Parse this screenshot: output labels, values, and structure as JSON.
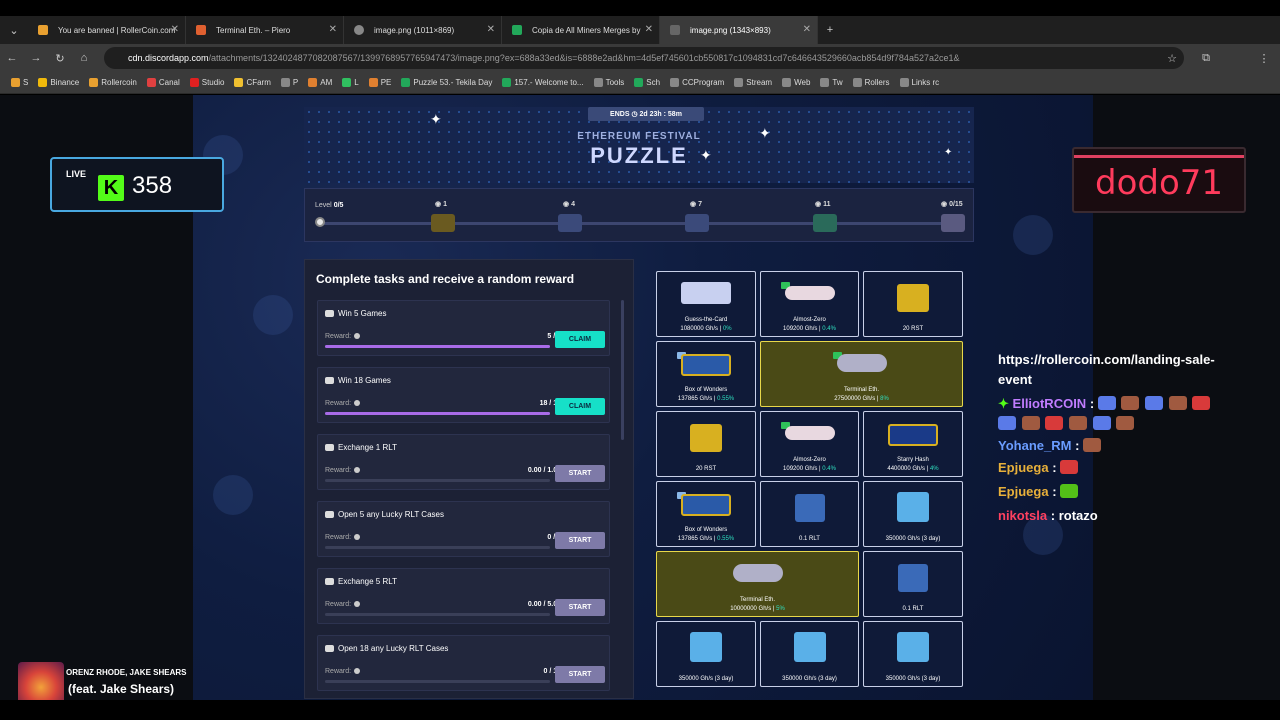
{
  "browser": {
    "tabs": [
      {
        "title": "You are banned | RollerCoin.com",
        "color": "#e8a030"
      },
      {
        "title": "Terminal Eth. – Piero",
        "color": "#e06030"
      },
      {
        "title": "image.png (1011×869)",
        "color": "#888888"
      },
      {
        "title": "Copia de All Miners Merges by",
        "color": "#22a85a"
      },
      {
        "title": "image.png (1343×893)",
        "color": "#888888"
      }
    ],
    "new_tab": "+",
    "url_host": "cdn.discordapp.com",
    "url_path": "/attachments/1324024877082087567/1399768957765947473/image.png?ex=688a33ed&is=6888e2ad&hm=4d5ef745601cb550817c1094831cd7c646643529660acb854d9f784a527a2ce1&",
    "bookmarks": [
      {
        "label": "S",
        "color": "#e8a030"
      },
      {
        "label": "Binance",
        "color": "#f0b90b"
      },
      {
        "label": "Rollercoin",
        "color": "#e8a030"
      },
      {
        "label": "Canal",
        "color": "#e04040"
      },
      {
        "label": "Studio",
        "color": "#e02020"
      },
      {
        "label": "CFarm",
        "color": "#f0c030"
      },
      {
        "label": "P",
        "color": "#888888"
      },
      {
        "label": "AM",
        "color": "#e08030"
      },
      {
        "label": "L",
        "color": "#30c060"
      },
      {
        "label": "PE",
        "color": "#e08030"
      },
      {
        "label": "Puzzle 53.- Tekila Day",
        "color": "#22a85a"
      },
      {
        "label": "157.- Welcome to...",
        "color": "#22a85a"
      },
      {
        "label": "Tools",
        "color": "#888888"
      },
      {
        "label": "Sch",
        "color": "#22a85a"
      },
      {
        "label": "CCProgram",
        "color": "#888888"
      },
      {
        "label": "Stream",
        "color": "#888888"
      },
      {
        "label": "Web",
        "color": "#888888"
      },
      {
        "label": "Tw",
        "color": "#888888"
      },
      {
        "label": "Rollers",
        "color": "#888888"
      },
      {
        "label": "Links rc",
        "color": "#888888"
      }
    ]
  },
  "event": {
    "ends_label": "ENDS",
    "ends_time": "2d 23h : 58m",
    "festival": "ETHEREUM FESTIVAL",
    "title": "PUZZLE"
  },
  "level": {
    "label": "Level",
    "value": "0/5",
    "milestones": [
      "1",
      "4",
      "7",
      "11",
      "0/15"
    ]
  },
  "tasks": {
    "title": "Complete tasks and receive a random reward",
    "reward_label": "Reward:",
    "items": [
      {
        "title": "Win 5 Games",
        "progress": "5 / 5",
        "fill": 1.0,
        "button": "CLAIM",
        "kind": "claim"
      },
      {
        "title": "Win 18 Games",
        "progress": "18 / 18",
        "fill": 1.0,
        "button": "CLAIM",
        "kind": "claim"
      },
      {
        "title": "Exchange 1 RLT",
        "progress": "0.00 / 1.00",
        "fill": 0.0,
        "button": "START",
        "kind": "start"
      },
      {
        "title": "Open 5 any Lucky RLT Cases",
        "progress": "0 / 5",
        "fill": 0.0,
        "button": "START",
        "kind": "start"
      },
      {
        "title": "Exchange 5 RLT",
        "progress": "0.00 / 5.00",
        "fill": 0.0,
        "button": "START",
        "kind": "start"
      },
      {
        "title": "Open 18 any Lucky RLT Cases",
        "progress": "0 / 18",
        "fill": 0.0,
        "button": "START",
        "kind": "start"
      }
    ]
  },
  "rewards": [
    {
      "name": "Guess-the-Card",
      "value": "1080000 Gh/s",
      "pct": "0%"
    },
    {
      "name": "Almost-Zero",
      "value": "109200 Gh/s",
      "pct": "0.4%"
    },
    {
      "name": "",
      "value": "20 RST",
      "pct": ""
    },
    {
      "name": "Box of Wonders",
      "value": "137865 Gh/s",
      "pct": "0.55%"
    },
    {
      "name": "Terminal Eth.",
      "value": "27500000 Gh/s",
      "pct": "8%"
    },
    {
      "name": "",
      "value": "20 RST",
      "pct": ""
    },
    {
      "name": "Almost-Zero",
      "value": "109200 Gh/s",
      "pct": "0.4%"
    },
    {
      "name": "Starry Hash",
      "value": "4400000 Gh/s",
      "pct": "4%"
    },
    {
      "name": "Box of Wonders",
      "value": "137865 Gh/s",
      "pct": "0.55%"
    },
    {
      "name": "",
      "value": "0.1 RLT",
      "pct": ""
    },
    {
      "name": "",
      "value": "350000 Gh/s (3 day)",
      "pct": ""
    },
    {
      "name": "Terminal Eth.",
      "value": "10000000 Gh/s",
      "pct": "5%"
    },
    {
      "name": "",
      "value": "0.1 RLT",
      "pct": ""
    },
    {
      "name": "",
      "value": "350000 Gh/s (3 day)",
      "pct": ""
    },
    {
      "name": "",
      "value": "350000 Gh/s (3 day)",
      "pct": ""
    },
    {
      "name": "",
      "value": "350000 Gh/s (3 day)",
      "pct": ""
    }
  ],
  "stream": {
    "live_label": "LIVE",
    "viewers": "358",
    "streamer": "dodo71",
    "artist": "ORENZ RHODE, JAKE SHEARS",
    "song": "(feat. Jake Shears)"
  },
  "chat": [
    {
      "user": "",
      "text": "https://rollercoin.com/landing-sale-",
      "color": "#ffffff"
    },
    {
      "user": "",
      "text": "event",
      "color": "#ffffff"
    },
    {
      "user": "ElliotRCOIN",
      "text": ":",
      "color": "#c07cff"
    },
    {
      "user": "Yohane_RM",
      "text": ":",
      "color": "#6a9cff"
    },
    {
      "user": "Epjuega",
      "text": ":",
      "color": "#e8b03a"
    },
    {
      "user": "Epjuega",
      "text": ":",
      "color": "#e8b03a"
    },
    {
      "user": "nikotsla",
      "text": ": rotazo",
      "color": "#ff4060"
    }
  ]
}
